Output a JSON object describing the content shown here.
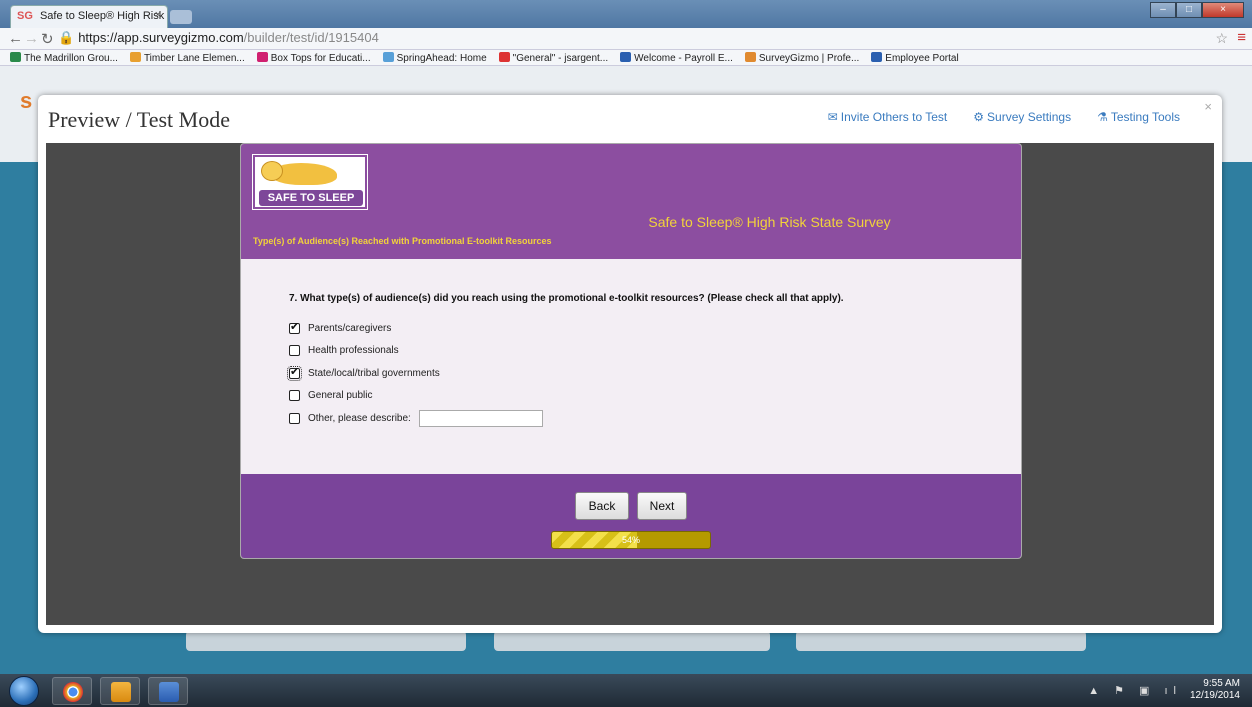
{
  "browser": {
    "tab_title": "Safe to Sleep® High Risk",
    "tab_favicon": "SG",
    "url_host": "https://app.surveygizmo.com",
    "url_path": "/builder/test/id/1915404",
    "bookmarks": [
      {
        "label": "The Madrillon Grou...",
        "icon": "green-icon",
        "color": "#2a8a4a"
      },
      {
        "label": "Timber Lane Elemen...",
        "icon": "school-icon",
        "color": "#e8a030"
      },
      {
        "label": "Box Tops for Educati...",
        "icon": "boxtops-icon",
        "color": "#d02070"
      },
      {
        "label": "SpringAhead: Home",
        "icon": "grid-icon",
        "color": "#58a0d8"
      },
      {
        "label": "\"General\" - jsargent...",
        "icon": "gmail-icon",
        "color": "#d33"
      },
      {
        "label": "Welcome - Payroll E...",
        "icon": "p-icon",
        "color": "#2a5fb0"
      },
      {
        "label": "SurveyGizmo | Profe...",
        "icon": "sg-icon",
        "color": "#e08a30"
      },
      {
        "label": "Employee Portal",
        "icon": "p-icon",
        "color": "#2a5fb0"
      }
    ]
  },
  "modal": {
    "title": "Preview / Test Mode",
    "links": [
      {
        "label": "Invite Others to Test",
        "icon": "envelope-icon"
      },
      {
        "label": "Survey Settings",
        "icon": "gear-icon"
      },
      {
        "label": "Testing Tools",
        "icon": "flask-icon"
      }
    ],
    "close": "×"
  },
  "survey": {
    "logo_text": "SAFE TO SLEEP",
    "title": "Safe to Sleep® High Risk State Survey",
    "subtitle": "Type(s) of Audience(s) Reached with Promotional E-toolkit Resources",
    "question": "7. What type(s) of audience(s) did you reach using the promotional e-toolkit resources? (Please check all that apply).",
    "options": [
      {
        "label": "Parents/caregivers",
        "checked": true
      },
      {
        "label": "Health professionals",
        "checked": false
      },
      {
        "label": "State/local/tribal governments",
        "checked": true
      },
      {
        "label": "General public",
        "checked": false
      },
      {
        "label": "Other, please describe:",
        "checked": false
      }
    ],
    "other_value": "",
    "back_label": "Back",
    "next_label": "Next",
    "progress_percent": 54,
    "progress_label": "54%"
  },
  "taskbar": {
    "time": "9:55 AM",
    "date": "12/19/2014"
  },
  "colors": {
    "survey_purple": "#8c4ea0",
    "footer_purple": "#7a449a",
    "title_yellow": "#f2d33a",
    "link_blue": "#3a7bbf"
  }
}
